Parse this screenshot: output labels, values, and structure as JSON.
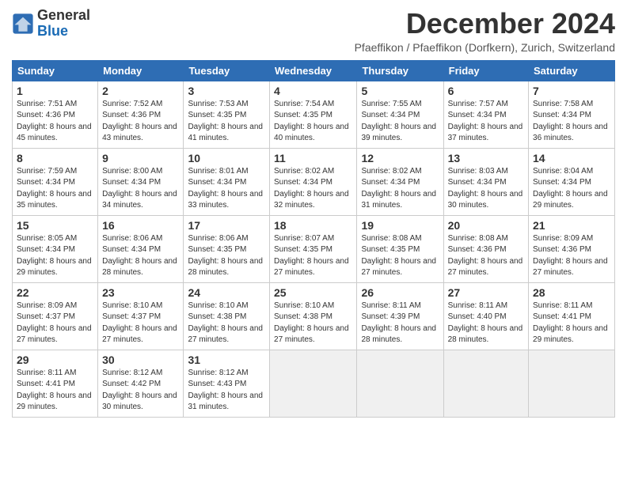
{
  "logo": {
    "general": "General",
    "blue": "Blue"
  },
  "title": "December 2024",
  "location": "Pfaeffikon / Pfaeffikon (Dorfkern), Zurich, Switzerland",
  "headers": [
    "Sunday",
    "Monday",
    "Tuesday",
    "Wednesday",
    "Thursday",
    "Friday",
    "Saturday"
  ],
  "weeks": [
    [
      {
        "day": "1",
        "sunrise": "7:51 AM",
        "sunset": "4:36 PM",
        "daylight": "8 hours and 45 minutes."
      },
      {
        "day": "2",
        "sunrise": "7:52 AM",
        "sunset": "4:36 PM",
        "daylight": "8 hours and 43 minutes."
      },
      {
        "day": "3",
        "sunrise": "7:53 AM",
        "sunset": "4:35 PM",
        "daylight": "8 hours and 41 minutes."
      },
      {
        "day": "4",
        "sunrise": "7:54 AM",
        "sunset": "4:35 PM",
        "daylight": "8 hours and 40 minutes."
      },
      {
        "day": "5",
        "sunrise": "7:55 AM",
        "sunset": "4:34 PM",
        "daylight": "8 hours and 39 minutes."
      },
      {
        "day": "6",
        "sunrise": "7:57 AM",
        "sunset": "4:34 PM",
        "daylight": "8 hours and 37 minutes."
      },
      {
        "day": "7",
        "sunrise": "7:58 AM",
        "sunset": "4:34 PM",
        "daylight": "8 hours and 36 minutes."
      }
    ],
    [
      {
        "day": "8",
        "sunrise": "7:59 AM",
        "sunset": "4:34 PM",
        "daylight": "8 hours and 35 minutes."
      },
      {
        "day": "9",
        "sunrise": "8:00 AM",
        "sunset": "4:34 PM",
        "daylight": "8 hours and 34 minutes."
      },
      {
        "day": "10",
        "sunrise": "8:01 AM",
        "sunset": "4:34 PM",
        "daylight": "8 hours and 33 minutes."
      },
      {
        "day": "11",
        "sunrise": "8:02 AM",
        "sunset": "4:34 PM",
        "daylight": "8 hours and 32 minutes."
      },
      {
        "day": "12",
        "sunrise": "8:02 AM",
        "sunset": "4:34 PM",
        "daylight": "8 hours and 31 minutes."
      },
      {
        "day": "13",
        "sunrise": "8:03 AM",
        "sunset": "4:34 PM",
        "daylight": "8 hours and 30 minutes."
      },
      {
        "day": "14",
        "sunrise": "8:04 AM",
        "sunset": "4:34 PM",
        "daylight": "8 hours and 29 minutes."
      }
    ],
    [
      {
        "day": "15",
        "sunrise": "8:05 AM",
        "sunset": "4:34 PM",
        "daylight": "8 hours and 29 minutes."
      },
      {
        "day": "16",
        "sunrise": "8:06 AM",
        "sunset": "4:34 PM",
        "daylight": "8 hours and 28 minutes."
      },
      {
        "day": "17",
        "sunrise": "8:06 AM",
        "sunset": "4:35 PM",
        "daylight": "8 hours and 28 minutes."
      },
      {
        "day": "18",
        "sunrise": "8:07 AM",
        "sunset": "4:35 PM",
        "daylight": "8 hours and 27 minutes."
      },
      {
        "day": "19",
        "sunrise": "8:08 AM",
        "sunset": "4:35 PM",
        "daylight": "8 hours and 27 minutes."
      },
      {
        "day": "20",
        "sunrise": "8:08 AM",
        "sunset": "4:36 PM",
        "daylight": "8 hours and 27 minutes."
      },
      {
        "day": "21",
        "sunrise": "8:09 AM",
        "sunset": "4:36 PM",
        "daylight": "8 hours and 27 minutes."
      }
    ],
    [
      {
        "day": "22",
        "sunrise": "8:09 AM",
        "sunset": "4:37 PM",
        "daylight": "8 hours and 27 minutes."
      },
      {
        "day": "23",
        "sunrise": "8:10 AM",
        "sunset": "4:37 PM",
        "daylight": "8 hours and 27 minutes."
      },
      {
        "day": "24",
        "sunrise": "8:10 AM",
        "sunset": "4:38 PM",
        "daylight": "8 hours and 27 minutes."
      },
      {
        "day": "25",
        "sunrise": "8:10 AM",
        "sunset": "4:38 PM",
        "daylight": "8 hours and 27 minutes."
      },
      {
        "day": "26",
        "sunrise": "8:11 AM",
        "sunset": "4:39 PM",
        "daylight": "8 hours and 28 minutes."
      },
      {
        "day": "27",
        "sunrise": "8:11 AM",
        "sunset": "4:40 PM",
        "daylight": "8 hours and 28 minutes."
      },
      {
        "day": "28",
        "sunrise": "8:11 AM",
        "sunset": "4:41 PM",
        "daylight": "8 hours and 29 minutes."
      }
    ],
    [
      {
        "day": "29",
        "sunrise": "8:11 AM",
        "sunset": "4:41 PM",
        "daylight": "8 hours and 29 minutes."
      },
      {
        "day": "30",
        "sunrise": "8:12 AM",
        "sunset": "4:42 PM",
        "daylight": "8 hours and 30 minutes."
      },
      {
        "day": "31",
        "sunrise": "8:12 AM",
        "sunset": "4:43 PM",
        "daylight": "8 hours and 31 minutes."
      },
      null,
      null,
      null,
      null
    ]
  ]
}
